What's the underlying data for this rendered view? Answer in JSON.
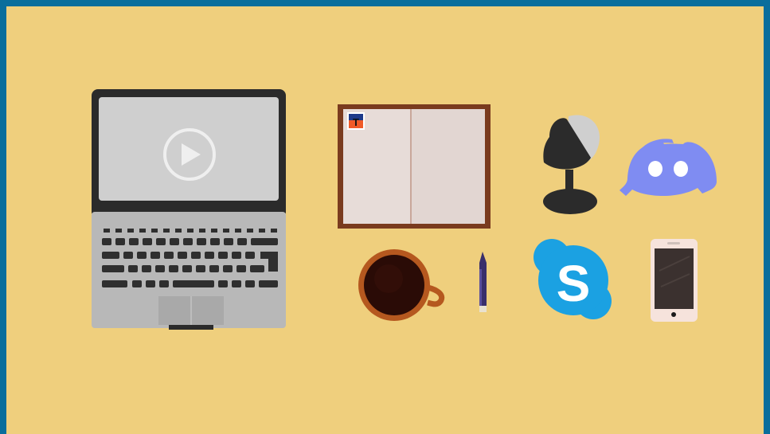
{
  "colors": {
    "background": "#efcf7d",
    "border": "#0a6e9c",
    "laptop_body": "#b9b9b9",
    "laptop_screen": "#cfcfcf",
    "notebook_frame": "#7a3b1e",
    "notebook_page": "#e2d6d2",
    "discord": "#7f8cf2",
    "skype": "#1ba1e2",
    "coffee": "#2a0b06",
    "phone_case": "#f6e3dc"
  },
  "icons": [
    "laptop-icon",
    "play-icon",
    "notebook-icon",
    "desk-lamp-icon",
    "discord-icon",
    "coffee-mug-icon",
    "pencil-icon",
    "skype-icon",
    "smartphone-icon"
  ],
  "notebook": {
    "badge_letter": "T"
  },
  "skype": {
    "letter": "S"
  }
}
